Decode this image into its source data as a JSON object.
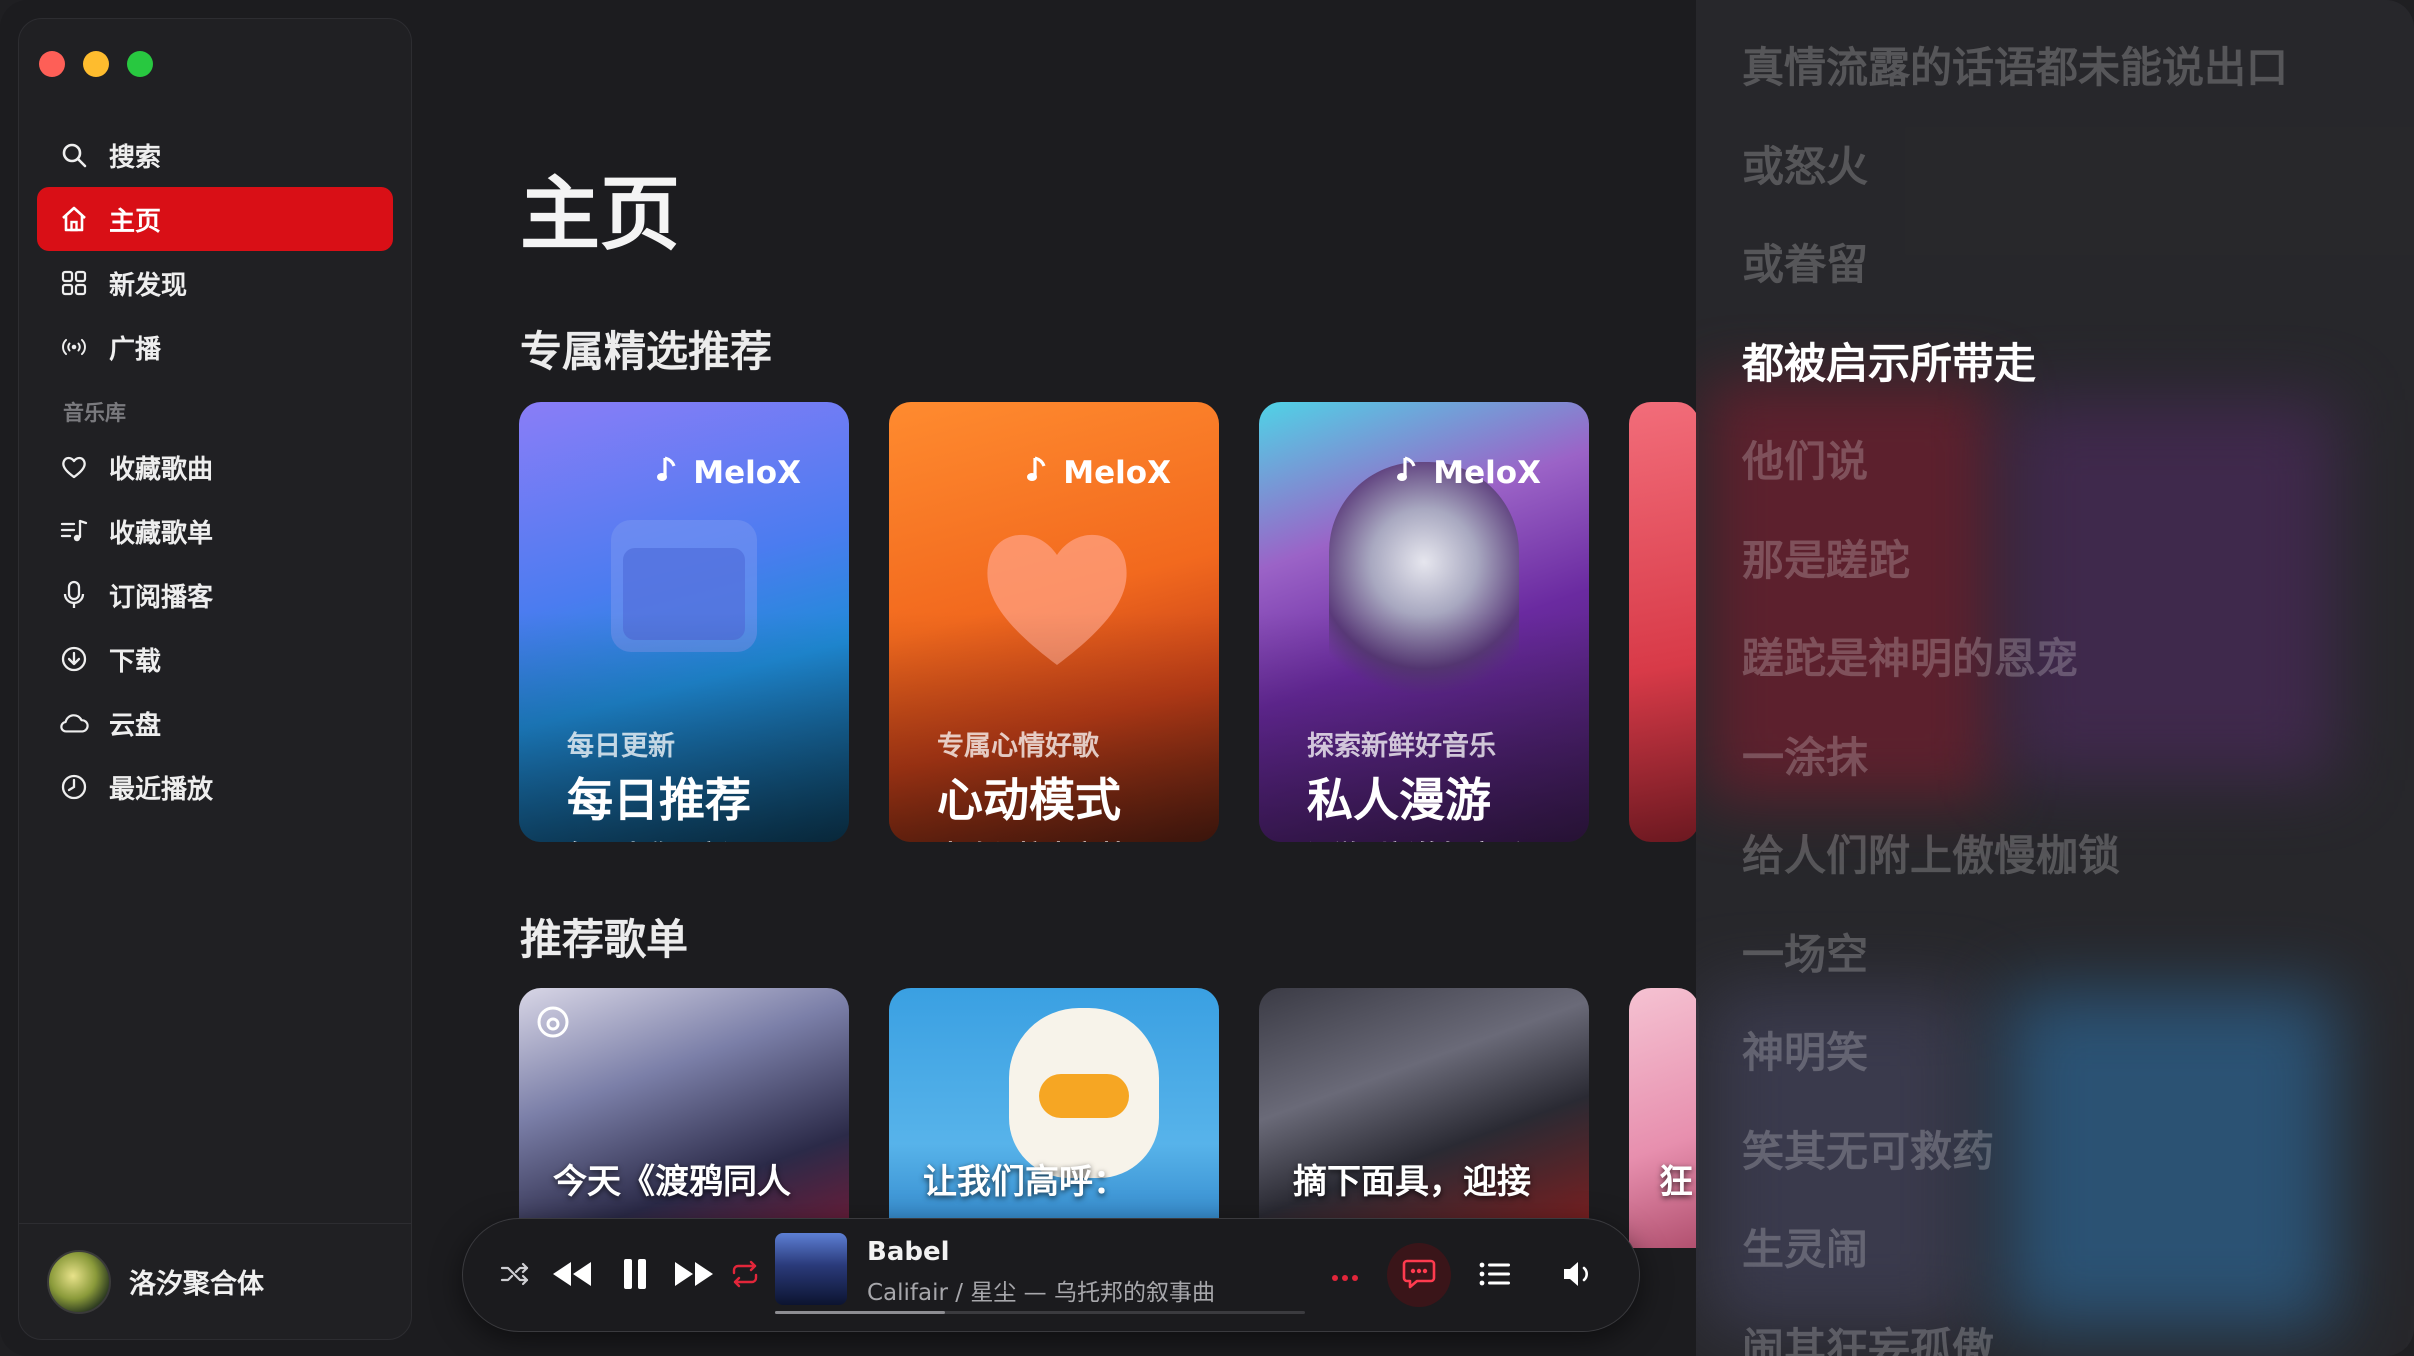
{
  "sidebar": {
    "nav": [
      {
        "label": "搜索",
        "icon": "search-icon"
      },
      {
        "label": "主页",
        "icon": "home-icon",
        "active": true
      },
      {
        "label": "新发现",
        "icon": "grid-icon"
      },
      {
        "label": "广播",
        "icon": "broadcast-icon"
      }
    ],
    "library_label": "音乐库",
    "library": [
      {
        "label": "收藏歌曲",
        "icon": "heart-icon"
      },
      {
        "label": "收藏歌单",
        "icon": "playlist-icon"
      },
      {
        "label": "订阅播客",
        "icon": "microphone-icon"
      },
      {
        "label": "下载",
        "icon": "download-icon"
      },
      {
        "label": "云盘",
        "icon": "cloud-icon"
      },
      {
        "label": "最近播放",
        "icon": "clock-icon"
      }
    ],
    "user": {
      "name": "洛汐聚合体"
    }
  },
  "main": {
    "title": "主页",
    "featured_title": "专属精选推荐",
    "featured": [
      {
        "brand": "MeloX",
        "eyebrow": "每日更新",
        "title": "每日推荐",
        "subtitle": "每天为你更新"
      },
      {
        "brand": "MeloX",
        "eyebrow": "专属心情好歌",
        "title": "心动模式",
        "subtitle": "喜欢与惊喜交替"
      },
      {
        "brand": "MeloX",
        "eyebrow": "探索新鲜好音乐",
        "title": "私人漫游",
        "subtitle": "漫游到新的好音乐"
      }
    ],
    "playlists_title": "推荐歌单",
    "playlists": [
      {
        "title": "今天《渡鸦同人"
      },
      {
        "title": "让我们高呼："
      },
      {
        "title": "摘下面具，迎接"
      },
      {
        "title": "狂"
      }
    ]
  },
  "player": {
    "track_title": "Babel",
    "track_subtitle": "Califair / 星尘 — 乌托邦的叙事曲",
    "progress": 0.32
  },
  "lyrics": {
    "lines": [
      "真情流露的话语都未能说出口",
      "或怒火",
      "或眷留",
      "都被启示所带走",
      "他们说",
      "那是蹉跎",
      "蹉跎是神明的恩宠",
      "一涂抹",
      "给人们附上傲慢枷锁",
      "一场空",
      "神明笑",
      "笑其无可救药",
      "生灵闹",
      "闹其狂妄孤傲"
    ],
    "current_index": 3
  },
  "colors": {
    "accent": "#d90f16",
    "background": "#1c1c1f"
  }
}
